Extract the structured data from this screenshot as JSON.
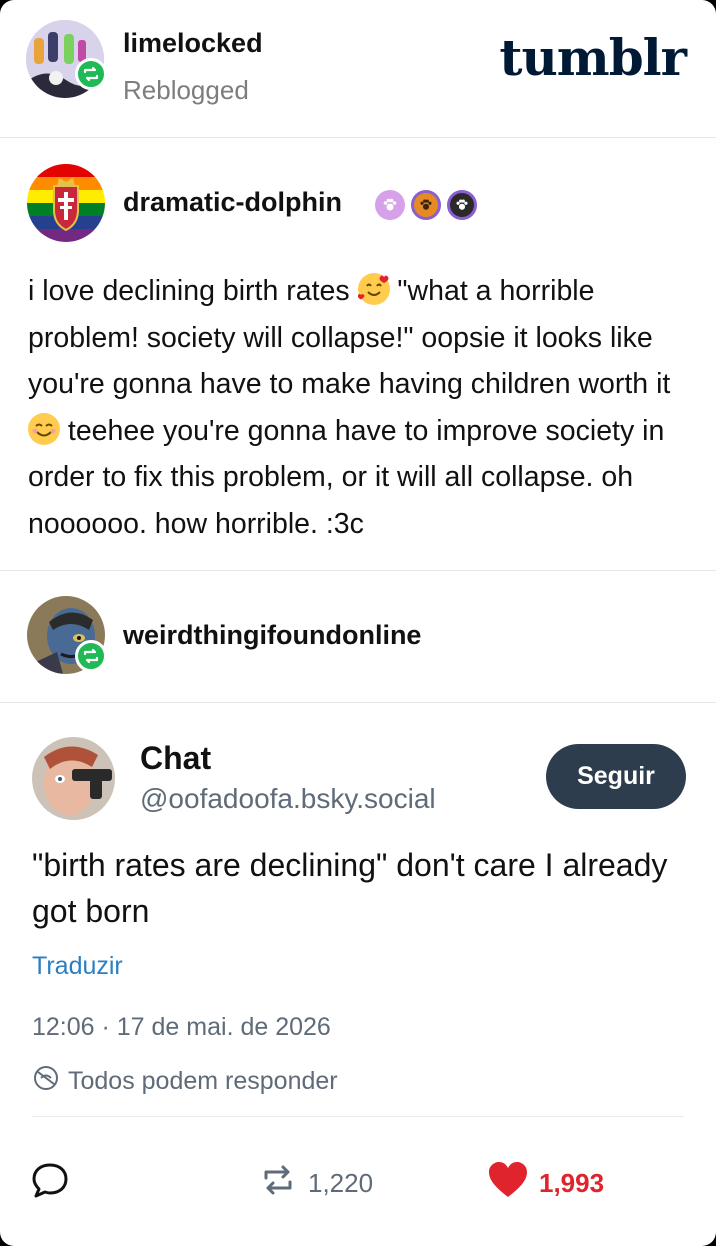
{
  "header": {
    "username": "limelocked",
    "status": "Reblogged",
    "logo": "tumblr"
  },
  "op": {
    "username": "dramatic-dolphin",
    "badges": [
      "paw-badge-purple",
      "paw-badge-orange",
      "paw-badge-dark"
    ],
    "text_parts": [
      "i love declining birth rates ",
      " \"what a horrible problem! society will collapse!\" oopsie it looks like you're gonna have to make having children worth it ",
      " teehee you're gonna have to improve society in order to fix this problem, or it will all collapse. oh noooooo. how horrible. :3c"
    ]
  },
  "reblogger": {
    "username": "weirdthingifoundonline"
  },
  "embed": {
    "display_name": "Chat",
    "handle": "@oofadoofa.bsky.social",
    "follow_label": "Seguir",
    "text": "\"birth rates are declining\" don't care I already got born",
    "translate_label": "Traduzir",
    "timestamp": "12:06 · 17 de mai. de 2026",
    "reply_setting": "Todos podem responder",
    "reposts": "1,220",
    "likes": "1,993"
  },
  "colors": {
    "reblog_green": "#1fb955",
    "like_red": "#e0242e",
    "follow_button": "#2e3d4d",
    "link_blue": "#2b7fc0",
    "logo_navy": "#001935"
  }
}
